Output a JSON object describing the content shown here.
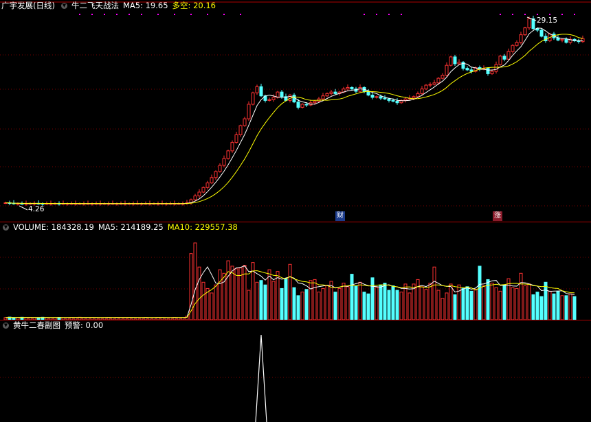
{
  "price_panel": {
    "title": "广宇发展(日线)",
    "indicator_name": "牛二飞天战法",
    "ma5_label": "MA5: 19.65",
    "duokong_label": "多空: 20.16",
    "high_label": "29.15",
    "low_label": "4.26",
    "event_markers": [
      "财",
      "涨"
    ],
    "colors": {
      "up": "#ff3232",
      "down": "#54ffff",
      "ma_white": "#ffffff",
      "ma_yellow": "#ffff00",
      "dots": "#ff00ff"
    }
  },
  "volume_panel": {
    "title": "VOLUME: 184328.19",
    "ma5_label": "MA5: 214189.25",
    "ma10_label": "MA10: 229557.38"
  },
  "indicator_panel": {
    "title": "黄牛二春副图",
    "alert_label": "预警: 0.00"
  },
  "chart_data": [
    {
      "type": "candlestick",
      "ylim": [
        4.0,
        30.5
      ],
      "closes": [
        4.4,
        4.35,
        4.3,
        4.3,
        4.28,
        4.3,
        4.32,
        4.33,
        4.3,
        4.28,
        4.3,
        4.3,
        4.32,
        4.3,
        4.3,
        4.3,
        4.3,
        4.3,
        4.3,
        4.3,
        4.3,
        4.3,
        4.3,
        4.3,
        4.3,
        4.3,
        4.3,
        4.3,
        4.3,
        4.3,
        4.3,
        4.3,
        4.3,
        4.3,
        4.3,
        4.3,
        4.3,
        4.3,
        4.3,
        4.3,
        4.3,
        4.3,
        4.3,
        4.3,
        4.4,
        4.8,
        5.3,
        5.8,
        6.4,
        7.0,
        7.7,
        8.5,
        9.3,
        10.2,
        11.2,
        12.3,
        13.3,
        14.5,
        15.4,
        17.3,
        18.8,
        19.6,
        18.4,
        17.8,
        17.9,
        18.2,
        18.9,
        18.3,
        17.8,
        18.5,
        17.6,
        16.9,
        17.3,
        17.2,
        17.5,
        17.7,
        18.0,
        18.4,
        18.7,
        18.9,
        18.7,
        18.9,
        19.3,
        19.5,
        19.3,
        19.0,
        19.5,
        19.0,
        18.5,
        18.2,
        18.3,
        18.1,
        18.0,
        17.8,
        17.7,
        17.5,
        17.8,
        18.0,
        18.1,
        18.3,
        18.7,
        19.3,
        19.8,
        19.9,
        20.1,
        20.7,
        21.1,
        22.4,
        23.5,
        22.6,
        22.8,
        22.0,
        21.8,
        21.6,
        22.1,
        21.9,
        22.0,
        21.3,
        21.6,
        22.5,
        23.6,
        23.2,
        24.2,
        25.0,
        25.4,
        26.4,
        27.3,
        28.5,
        27.2,
        27.0,
        26.2,
        25.6,
        26.5,
        26.0,
        25.7,
        25.8,
        25.4,
        25.8,
        25.6,
        25.5,
        25.9
      ],
      "high_value": 29.15,
      "low_value": 4.26
    },
    {
      "type": "bar",
      "ylim": [
        0,
        480000
      ],
      "values": [
        12000,
        15000,
        11000,
        13000,
        14000,
        12000,
        13000,
        12000,
        11000,
        14000,
        12000,
        11000,
        12000,
        13000,
        12000,
        11000,
        13000,
        12000,
        14000,
        11000,
        12000,
        13000,
        12000,
        11000,
        12000,
        13000,
        12000,
        13000,
        12000,
        11000,
        13000,
        12000,
        12000,
        11000,
        13000,
        12000,
        12000,
        13000,
        12000,
        11000,
        12000,
        13000,
        12000,
        12000,
        20000,
        370000,
        430000,
        295000,
        210000,
        175000,
        150000,
        195000,
        280000,
        260000,
        330000,
        300000,
        285000,
        290000,
        305000,
        165000,
        320000,
        210000,
        220000,
        195000,
        280000,
        215000,
        270000,
        175000,
        230000,
        310000,
        180000,
        135000,
        155000,
        170000,
        220000,
        225000,
        155000,
        175000,
        190000,
        215000,
        155000,
        175000,
        205000,
        185000,
        255000,
        190000,
        210000,
        155000,
        145000,
        235000,
        180000,
        195000,
        205000,
        165000,
        190000,
        165000,
        155000,
        200000,
        150000,
        200000,
        225000,
        185000,
        170000,
        205000,
        295000,
        165000,
        120000,
        150000,
        200000,
        140000,
        195000,
        175000,
        185000,
        160000,
        170000,
        300000,
        190000,
        225000,
        205000,
        180000,
        160000,
        195000,
        230000,
        180000,
        175000,
        260000,
        190000,
        200000,
        140000,
        155000,
        130000,
        210000,
        160000,
        145000,
        160000,
        135000,
        135000,
        145000,
        130000
      ]
    }
  ]
}
